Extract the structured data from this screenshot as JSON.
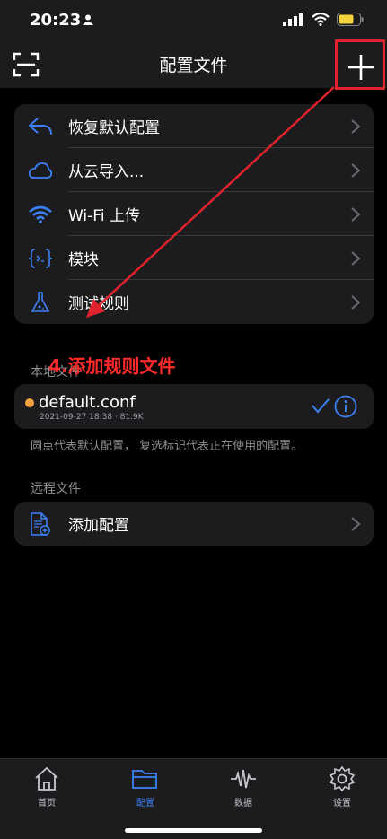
{
  "status": {
    "time": "20:23"
  },
  "nav": {
    "title": "配置文件"
  },
  "menu": [
    {
      "label": "恢复默认配置",
      "icon": "undo-arrow-icon"
    },
    {
      "label": "从云导入...",
      "icon": "cloud-icon"
    },
    {
      "label": "Wi-Fi 上传",
      "icon": "wifi-icon"
    },
    {
      "label": "模块",
      "icon": "code-braces-icon"
    },
    {
      "label": "测试规则",
      "icon": "flask-icon"
    }
  ],
  "annotation": "4.添加规则文件",
  "local": {
    "section": "本地文件",
    "profile": {
      "name": "default.conf",
      "meta": "2021-09-27 18:38 · 81.9K"
    },
    "hint": "圆点代表默认配置， 复选标记代表正在使用的配置。"
  },
  "remote": {
    "section": "远程文件",
    "add_label": "添加配置"
  },
  "tabs": [
    {
      "label": "首页",
      "icon": "home-icon"
    },
    {
      "label": "配置",
      "icon": "folder-icon"
    },
    {
      "label": "数据",
      "icon": "waveform-icon"
    },
    {
      "label": "设置",
      "icon": "gear-icon"
    }
  ],
  "colors": {
    "accent": "#3b82f6",
    "highlight": "#e0222c",
    "default_dot": "#f5a13c"
  }
}
